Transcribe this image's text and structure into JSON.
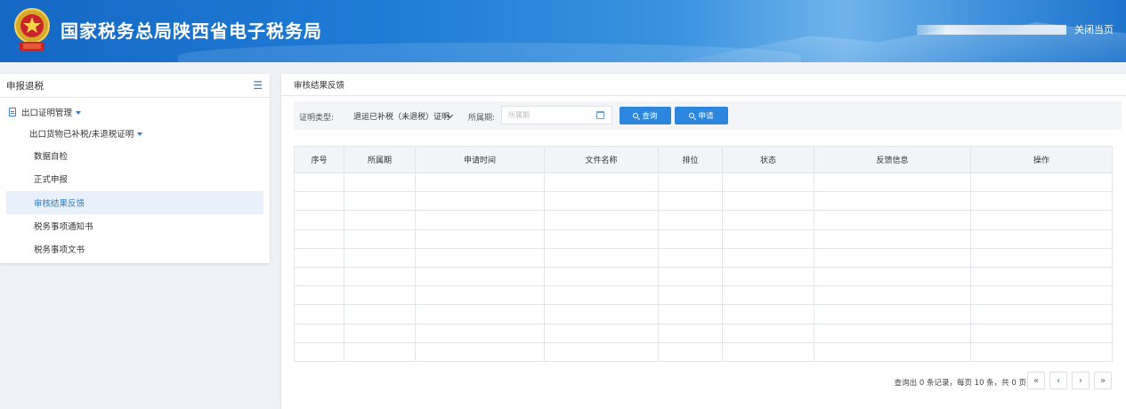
{
  "header": {
    "site_title": "国家税务总局陕西省电子税务局",
    "close_label": "关闭当页"
  },
  "sidebar": {
    "title": "申报退税",
    "level1": "出口证明管理",
    "level2": "出口货物已补税/未退税证明",
    "items": [
      {
        "label": "数据自检"
      },
      {
        "label": "正式申报"
      },
      {
        "label": "审核结果反馈"
      },
      {
        "label": "税务事项通知书"
      },
      {
        "label": "税务事项文书"
      }
    ],
    "active_index": 2
  },
  "main": {
    "title": "审核结果反馈",
    "filters": {
      "type_label": "证明类型:",
      "type_value": "退运已补税（未退税）证明",
      "period_label": "所属期:",
      "period_placeholder": "所属期",
      "query_label": "查询",
      "apply_label": "申请"
    },
    "table": {
      "headers": [
        "序号",
        "所属期",
        "申请时间",
        "文件名称",
        "排位",
        "状态",
        "反馈信息",
        "操作"
      ],
      "row_count": 10
    },
    "pager": {
      "summary": "查询出 0 条记录，每页 10 条，共 0 页",
      "first": "«",
      "prev": "‹",
      "next": "›",
      "last": "»"
    }
  },
  "colors": {
    "accent": "#2c86dd",
    "header_blue": "#1f7dd6",
    "active_bg": "#e8f1fb"
  }
}
